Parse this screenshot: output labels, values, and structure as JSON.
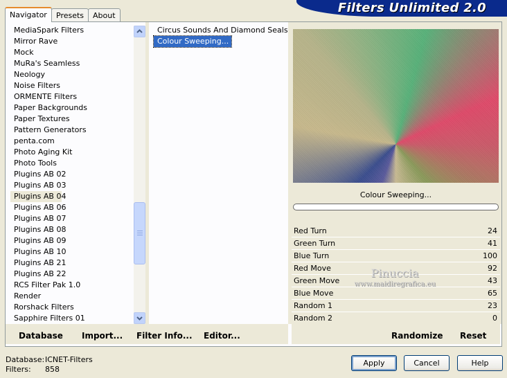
{
  "app": {
    "title": "Filters Unlimited 2.0"
  },
  "tabs": [
    {
      "label": "Navigator",
      "active": true
    },
    {
      "label": "Presets",
      "active": false
    },
    {
      "label": "About",
      "active": false
    }
  ],
  "categories": {
    "items": [
      "MediaSpark Filters",
      "Mirror Rave",
      "Mock",
      "MuRa's Seamless",
      "Neology",
      "Noise Filters",
      "ORMENTE Filters",
      "Paper Backgrounds",
      "Paper Textures",
      "Pattern Generators",
      "penta.com",
      "Photo Aging Kit",
      "Photo Tools",
      "Plugins AB 02",
      "Plugins AB 03",
      "Plugins AB 04",
      "Plugins AB 06",
      "Plugins AB 07",
      "Plugins AB 08",
      "Plugins AB 09",
      "Plugins AB 10",
      "Plugins AB 21",
      "Plugins AB 22",
      "RCS Filter Pak 1.0",
      "Render",
      "Rorshack Filters",
      "Sapphire Filters 01"
    ],
    "selected_index": 15
  },
  "filters": {
    "items": [
      "Circus Sounds And Diamond Seals...",
      "Colour Sweeping..."
    ],
    "selected_index": 1
  },
  "preview": {
    "filter_name": "Colour Sweeping...",
    "progress": 0
  },
  "params": [
    {
      "name": "Red Turn",
      "value": "24"
    },
    {
      "name": "Green Turn",
      "value": "41"
    },
    {
      "name": "Blue Turn",
      "value": "100"
    },
    {
      "name": "Red Move",
      "value": "92"
    },
    {
      "name": "Green Move",
      "value": "43"
    },
    {
      "name": "Blue Move",
      "value": "65"
    },
    {
      "name": "Random 1",
      "value": "23"
    },
    {
      "name": "Random 2",
      "value": "0"
    }
  ],
  "watermark": {
    "name": "Pinuccia",
    "site": "www.maidiregrafica.eu"
  },
  "toolbar": {
    "database": "Database",
    "import": "Import...",
    "filter_info": "Filter Info...",
    "editor": "Editor...",
    "randomize": "Randomize",
    "reset": "Reset"
  },
  "status": {
    "database_label": "Database:",
    "database_value": "ICNET-Filters",
    "filters_label": "Filters:",
    "filters_value": "858"
  },
  "buttons": {
    "apply": "Apply",
    "cancel": "Cancel",
    "help": "Help"
  }
}
